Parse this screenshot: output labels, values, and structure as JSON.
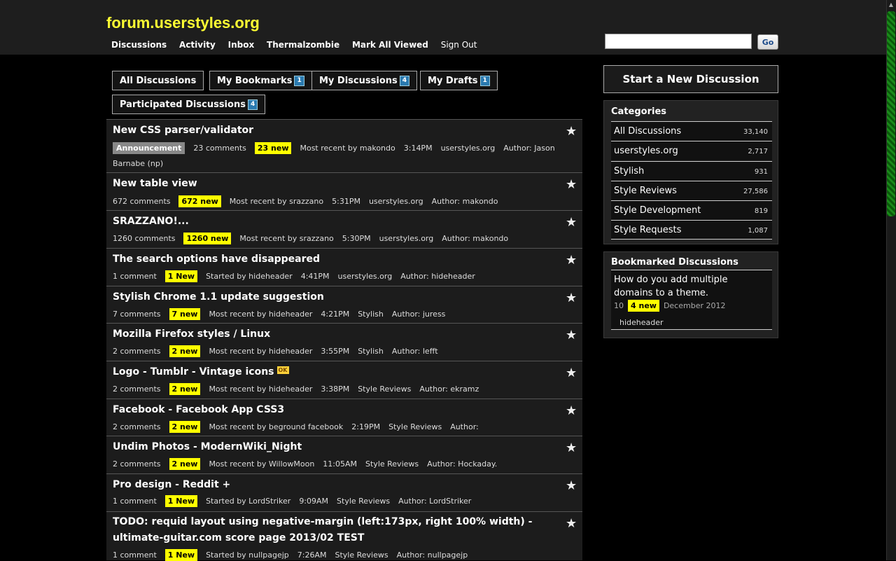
{
  "site": {
    "title": "forum.userstyles.org"
  },
  "topnav": [
    "Discussions",
    "Activity",
    "Inbox",
    "Thermalzombie",
    "Mark All Viewed"
  ],
  "signout": "Sign Out",
  "search": {
    "placeholder": "",
    "go_label": "Go"
  },
  "tabs": [
    {
      "label": "All Discussions",
      "count": ""
    },
    {
      "label": "My Bookmarks",
      "count": "1"
    },
    {
      "label": "My Discussions",
      "count": "4"
    },
    {
      "label": "My Drafts",
      "count": "1"
    },
    {
      "label": "Participated Discussions",
      "count": "4"
    }
  ],
  "discussions": [
    {
      "title": "New CSS parser/validator",
      "tag": "Announcement",
      "comments": "23 comments",
      "new": "23 new",
      "recent": "Most recent by makondo",
      "time": "3:14PM",
      "category": "userstyles.org",
      "author": "Author: Jason",
      "author_cont": "Barnabe (np)"
    },
    {
      "title": "New table view",
      "comments": "672 comments",
      "new": "672 new",
      "recent": "Most recent by srazzano",
      "time": "5:31PM",
      "category": "userstyles.org",
      "author": "Author: makondo"
    },
    {
      "title": "SRAZZANO!...",
      "comments": "1260 comments",
      "new": "1260 new",
      "recent": "Most recent by srazzano",
      "time": "5:30PM",
      "category": "userstyles.org",
      "author": "Author: makondo"
    },
    {
      "title": "The search options have disappeared",
      "comments": "1 comment",
      "new": "1 New",
      "recent": "Started by hideheader",
      "time": "4:41PM",
      "category": "userstyles.org",
      "author": "Author: hideheader"
    },
    {
      "title": "Stylish Chrome 1.1 update suggestion",
      "comments": "7 comments",
      "new": "7 new",
      "recent": "Most recent by hideheader",
      "time": "4:21PM",
      "category": "Stylish",
      "author": "Author: juress"
    },
    {
      "title": "Mozilla Firefox styles / Linux",
      "comments": "2 comments",
      "new": "2 new",
      "recent": "Most recent by hideheader",
      "time": "3:55PM",
      "category": "Stylish",
      "author": "Author: lefft"
    },
    {
      "title": "Logo - Tumblr - Vintage icons",
      "ok": "OK",
      "comments": "2 comments",
      "new": "2 new",
      "recent": "Most recent by hideheader",
      "time": "3:38PM",
      "category": "Style Reviews",
      "author": "Author: ekramz"
    },
    {
      "title": "Facebook - Facebook App CSS3",
      "comments": "2 comments",
      "new": "2 new",
      "recent": "Most recent by beground facebook",
      "time": "2:19PM",
      "category": "Style Reviews",
      "author": "Author:"
    },
    {
      "title": "Undim Photos - ModernWiki_Night",
      "comments": "2 comments",
      "new": "2 new",
      "recent": "Most recent by WillowMoon",
      "time": "11:05AM",
      "category": "Style Reviews",
      "author": "Author: Hockaday."
    },
    {
      "title": "Pro design - Reddit +",
      "comments": "1 comment",
      "new": "1 New",
      "recent": "Started by LordStriker",
      "time": "9:09AM",
      "category": "Style Reviews",
      "author": "Author: LordStriker"
    },
    {
      "title": "TODO: requid layout using negative-margin (left:173px, right 100% width) - ultimate-guitar.com score page 2013/02 TEST",
      "comments": "1 comment",
      "new": "1 New",
      "recent": "Started by nullpagejp",
      "time": "7:26AM",
      "category": "Style Reviews",
      "author": "Author: nullpagejp"
    }
  ],
  "sidebar": {
    "new_discussion": "Start a New Discussion",
    "categories_title": "Categories",
    "categories": [
      {
        "name": "All Discussions",
        "count": "33,140"
      },
      {
        "name": "userstyles.org",
        "count": "2,717"
      },
      {
        "name": "Stylish",
        "count": "931"
      },
      {
        "name": "Style Reviews",
        "count": "27,586"
      },
      {
        "name": "Style Development",
        "count": "819"
      },
      {
        "name": "Style Requests",
        "count": "1,087"
      }
    ],
    "bookmarks_title": "Bookmarked Discussions",
    "bookmark": {
      "title": "How do you add multiple domains to a theme.",
      "comments": "10",
      "new": "4 new",
      "date": "December 2012",
      "user": "hideheader"
    }
  },
  "colors": {
    "accent": "#ffff33",
    "new_badge": "#ffff00",
    "background": "#000000",
    "count_badge": "#2a7ab0"
  }
}
